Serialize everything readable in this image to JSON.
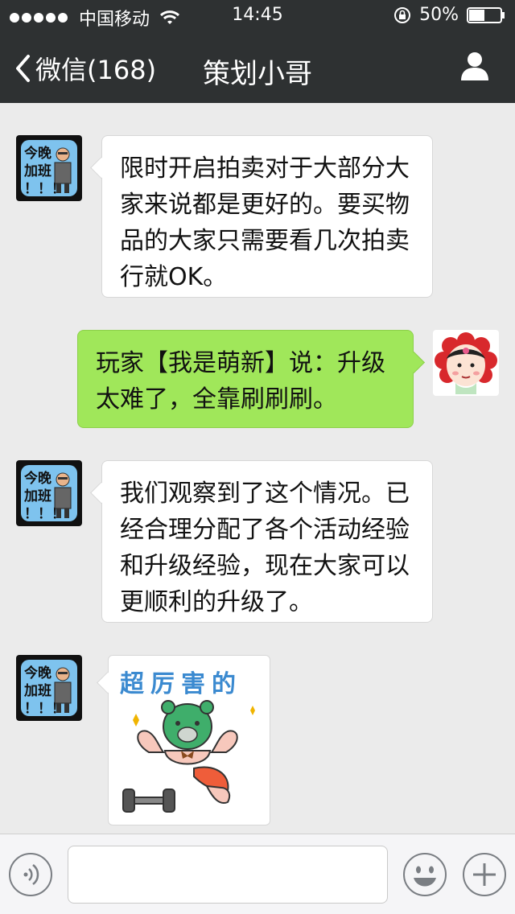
{
  "status_bar": {
    "carrier": "中国移动",
    "time": "14:45",
    "battery": "50%",
    "signal_bars": 5,
    "battery_level": 0.5
  },
  "nav": {
    "back_label": "微信(168)",
    "title": "策划小哥",
    "right_icon": "user-icon"
  },
  "avatars": {
    "boss_text": "今晚加班！！！",
    "boss_lines": [
      "今晚",
      "加班",
      "！！！"
    ]
  },
  "messages": [
    {
      "side": "left",
      "type": "text",
      "text": "限时开启拍卖对于大部分大家来说都是更好的。要买物品的大家只需要看几次拍卖行就OK。"
    },
    {
      "side": "right",
      "type": "text",
      "text": "玩家【我是萌新】说：升级太难了，全靠刷刷刷。"
    },
    {
      "side": "left",
      "type": "text",
      "text": "我们观察到了这个情况。已经合理分配了各个活动经验和升级经验，现在大家可以更顺利的升级了。"
    },
    {
      "side": "left",
      "type": "sticker",
      "text": "超厉害的"
    }
  ],
  "input_bar": {
    "voice_icon": "voice-icon",
    "input_value": "",
    "emoji_icon": "emoji-icon",
    "add_icon": "plus-icon"
  },
  "colors": {
    "topbar": "#2e3132",
    "background": "#ebebeb",
    "bubble_green": "#a0e75a",
    "bubble_white": "#ffffff",
    "sticker_text": "#3b8ad0"
  }
}
